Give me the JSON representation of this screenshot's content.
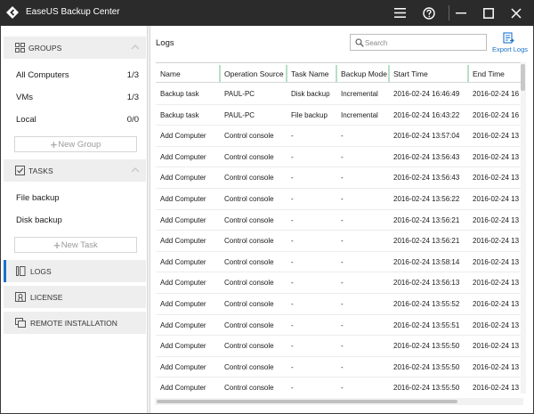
{
  "window": {
    "title": "EaseUS Backup Center",
    "colors": {
      "titlebar": "#2b2b2b",
      "accent": "#1a73c9",
      "column_separator": "#b6e0c8"
    }
  },
  "sidebar": {
    "groups": {
      "header": "GROUPS",
      "items": [
        {
          "label": "All Computers",
          "count": "1/3"
        },
        {
          "label": "VMs",
          "count": "1/3"
        },
        {
          "label": "Local",
          "count": "0/0"
        }
      ],
      "add_label": "New Group"
    },
    "tasks": {
      "header": "TASKS",
      "items": [
        {
          "label": "File backup"
        },
        {
          "label": "Disk backup"
        }
      ],
      "add_label": "New Task"
    },
    "items": [
      {
        "label": "LOGS",
        "icon": "logs-icon",
        "active": true
      },
      {
        "label": "LICENSE",
        "icon": "license-icon",
        "active": false
      },
      {
        "label": "REMOTE INSTALLATION",
        "icon": "remote-install-icon",
        "active": false
      }
    ]
  },
  "main": {
    "title": "Logs",
    "search_placeholder": "Search",
    "export_label": "Export Logs",
    "columns": [
      "Name",
      "Operation Source",
      "Task Name",
      "Backup Mode",
      "Start Time",
      "End Time"
    ],
    "rows": [
      [
        "Backup task",
        "PAUL-PC",
        "Disk backup",
        "Incremental",
        "2016-02-24 16:46:49",
        "2016-02-24 16"
      ],
      [
        "Backup task",
        "PAUL-PC",
        "File backup",
        "Incremental",
        "2016-02-24 16:43:22",
        "2016-02-24 16"
      ],
      [
        "Add Computer",
        "Control console",
        "-",
        "-",
        "2016-02-24 13:57:04",
        "2016-02-24 13"
      ],
      [
        "Add Computer",
        "Control console",
        "-",
        "-",
        "2016-02-24 13:56:43",
        "2016-02-24 13"
      ],
      [
        "Add Computer",
        "Control console",
        "-",
        "-",
        "2016-02-24 13:56:43",
        "2016-02-24 13"
      ],
      [
        "Add Computer",
        "Control console",
        "-",
        "-",
        "2016-02-24 13:56:22",
        "2016-02-24 13"
      ],
      [
        "Add Computer",
        "Control console",
        "-",
        "-",
        "2016-02-24 13:56:21",
        "2016-02-24 13"
      ],
      [
        "Add Computer",
        "Control console",
        "-",
        "-",
        "2016-02-24 13:56:21",
        "2016-02-24 13"
      ],
      [
        "Add Computer",
        "Control console",
        "-",
        "-",
        "2016-02-24 13:58:14",
        "2016-02-24 13"
      ],
      [
        "Add Computer",
        "Control console",
        "-",
        "-",
        "2016-02-24 13:56:13",
        "2016-02-24 13"
      ],
      [
        "Add Computer",
        "Control console",
        "-",
        "-",
        "2016-02-24 13:55:52",
        "2016-02-24 13"
      ],
      [
        "Add Computer",
        "Control console",
        "-",
        "-",
        "2016-02-24 13:55:51",
        "2016-02-24 13"
      ],
      [
        "Add Computer",
        "Control console",
        "-",
        "-",
        "2016-02-24 13:55:50",
        "2016-02-24 13"
      ],
      [
        "Add Computer",
        "Control console",
        "-",
        "-",
        "2016-02-24 13:55:50",
        "2016-02-24 13"
      ],
      [
        "Add Computer",
        "Control console",
        "-",
        "-",
        "2016-02-24 13:55:50",
        "2016-02-24 13"
      ]
    ]
  }
}
